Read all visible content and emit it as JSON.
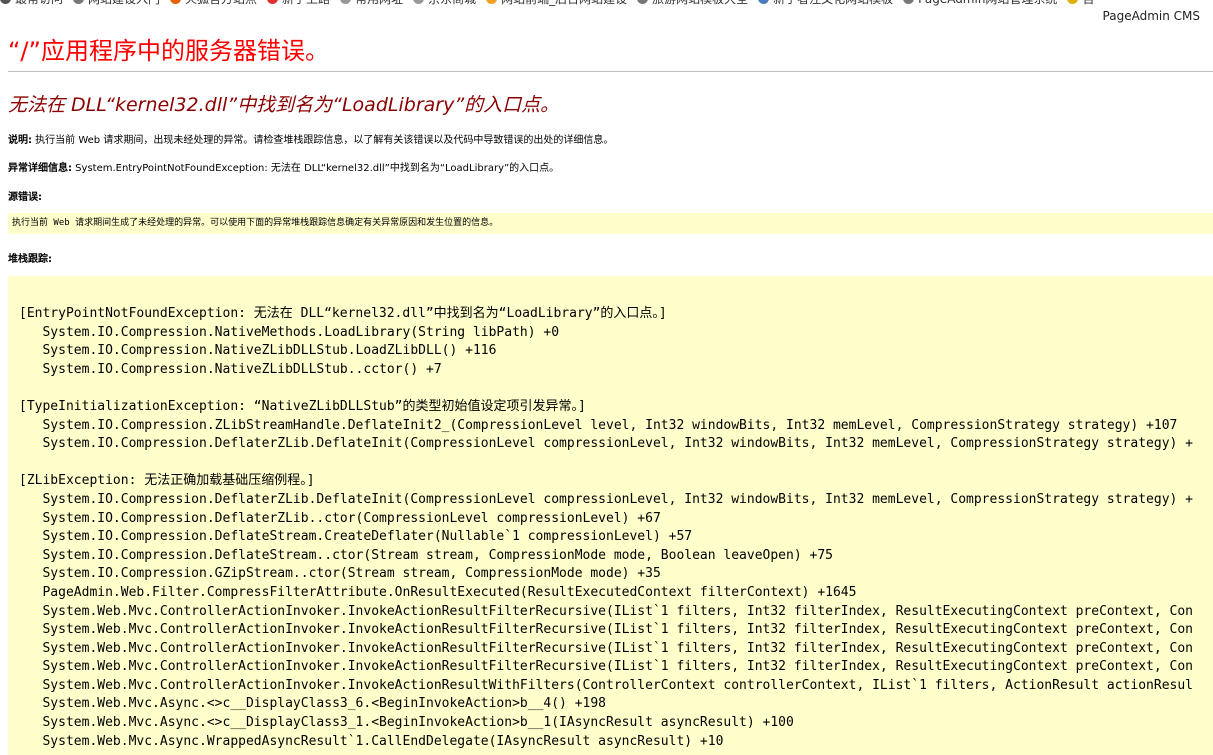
{
  "bookmarks": [
    {
      "label": "最常访问",
      "icon": "gear-icon",
      "color": "#555555"
    },
    {
      "label": "网站建设入门",
      "icon": "globe-icon",
      "color": "#777777"
    },
    {
      "label": "火狐官方站点",
      "icon": "firefox-icon",
      "color": "#e66000"
    },
    {
      "label": "新手上路",
      "icon": "firefox-icon",
      "color": "#e03030"
    },
    {
      "label": "常用网址",
      "icon": "folder-icon",
      "color": "#999999"
    },
    {
      "label": "京东商城",
      "icon": "folder-icon",
      "color": "#999999"
    },
    {
      "label": "网站前端_后台网站建设",
      "icon": "globe-icon",
      "color": "#f0a020"
    },
    {
      "label": "旅游网站模板大全",
      "icon": "globe-icon",
      "color": "#777777"
    },
    {
      "label": "新手者注文化网站模板",
      "icon": "page-icon",
      "color": "#4a7ac0"
    },
    {
      "label": "PageAdmin网站管理系统",
      "icon": "globe-icon",
      "color": "#777777"
    },
    {
      "label": "百",
      "icon": "globe-icon",
      "color": "#e0b000"
    }
  ],
  "brand": "PageAdmin CMS",
  "title": "“/”应用程序中的服务器错误。",
  "subtitle": "无法在 DLL“kernel32.dll”中找到名为“LoadLibrary”的入口点。",
  "description": {
    "label": "说明:",
    "text": " 执行当前 Web 请求期间，出现未经处理的异常。请检查堆栈跟踪信息，以了解有关该错误以及代码中导致错误的出处的详细信息。"
  },
  "exception_details": {
    "label": "异常详细信息:",
    "text": " System.EntryPointNotFoundException: 无法在 DLL“kernel32.dll”中找到名为“LoadLibrary”的入口点。"
  },
  "source_error": {
    "label": "源错误:",
    "text": "执行当前 Web 请求期间生成了未经处理的异常。可以使用下面的异常堆栈跟踪信息确定有关异常原因和发生位置的信息。"
  },
  "stack_trace": {
    "label": "堆栈跟踪:",
    "lines": [
      "[EntryPointNotFoundException: 无法在 DLL“kernel32.dll”中找到名为“LoadLibrary”的入口点。]",
      "   System.IO.Compression.NativeMethods.LoadLibrary(String libPath) +0",
      "   System.IO.Compression.NativeZLibDLLStub.LoadZLibDLL() +116",
      "   System.IO.Compression.NativeZLibDLLStub..cctor() +7",
      "",
      "[TypeInitializationException: “NativeZLibDLLStub”的类型初始值设定项引发异常。]",
      "   System.IO.Compression.ZLibStreamHandle.DeflateInit2_(CompressionLevel level, Int32 windowBits, Int32 memLevel, CompressionStrategy strategy) +107",
      "   System.IO.Compression.DeflaterZLib.DeflateInit(CompressionLevel compressionLevel, Int32 windowBits, Int32 memLevel, CompressionStrategy strategy) +",
      "",
      "[ZLibException: 无法正确加载基础压缩例程。]",
      "   System.IO.Compression.DeflaterZLib.DeflateInit(CompressionLevel compressionLevel, Int32 windowBits, Int32 memLevel, CompressionStrategy strategy) +",
      "   System.IO.Compression.DeflaterZLib..ctor(CompressionLevel compressionLevel) +67",
      "   System.IO.Compression.DeflateStream.CreateDeflater(Nullable`1 compressionLevel) +57",
      "   System.IO.Compression.DeflateStream..ctor(Stream stream, CompressionMode mode, Boolean leaveOpen) +75",
      "   System.IO.Compression.GZipStream..ctor(Stream stream, CompressionMode mode) +35",
      "   PageAdmin.Web.Filter.CompressFilterAttribute.OnResultExecuted(ResultExecutedContext filterContext) +1645",
      "   System.Web.Mvc.ControllerActionInvoker.InvokeActionResultFilterRecursive(IList`1 filters, Int32 filterIndex, ResultExecutingContext preContext, Con",
      "   System.Web.Mvc.ControllerActionInvoker.InvokeActionResultFilterRecursive(IList`1 filters, Int32 filterIndex, ResultExecutingContext preContext, Con",
      "   System.Web.Mvc.ControllerActionInvoker.InvokeActionResultFilterRecursive(IList`1 filters, Int32 filterIndex, ResultExecutingContext preContext, Con",
      "   System.Web.Mvc.ControllerActionInvoker.InvokeActionResultFilterRecursive(IList`1 filters, Int32 filterIndex, ResultExecutingContext preContext, Con",
      "   System.Web.Mvc.ControllerActionInvoker.InvokeActionResultWithFilters(ControllerContext controllerContext, IList`1 filters, ActionResult actionResul",
      "   System.Web.Mvc.Async.<>c__DisplayClass3_6.<BeginInvokeAction>b__4() +198",
      "   System.Web.Mvc.Async.<>c__DisplayClass3_1.<BeginInvokeAction>b__1(IAsyncResult asyncResult) +100",
      "   System.Web.Mvc.Async.WrappedAsyncResult`1.CallEndDelegate(IAsyncResult asyncResult) +10"
    ]
  }
}
